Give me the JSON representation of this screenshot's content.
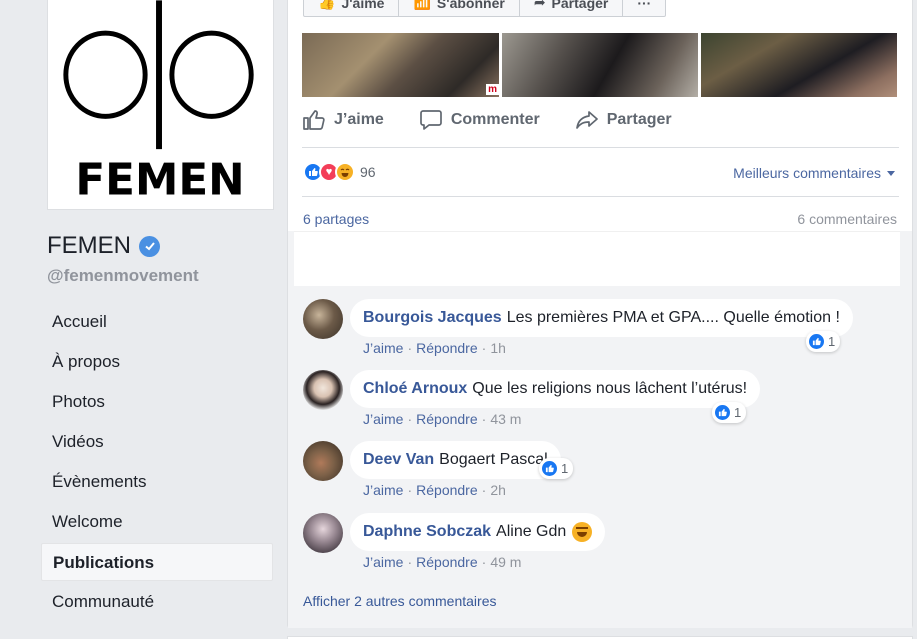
{
  "colors": {
    "link": "#385898",
    "accent": "#1877f2",
    "background": "#e9ebee"
  },
  "profile": {
    "logo_text": "FEMEN",
    "name": "FEMEN",
    "handle": "@femenmovement",
    "verified_icon": "verified-badge-icon"
  },
  "nav": {
    "items": [
      {
        "label": "Accueil"
      },
      {
        "label": "À propos"
      },
      {
        "label": "Photos"
      },
      {
        "label": "Vidéos"
      },
      {
        "label": "Évènements"
      },
      {
        "label": "Welcome"
      },
      {
        "label": "Publications",
        "active": true
      },
      {
        "label": "Communauté"
      }
    ]
  },
  "post": {
    "top_buttons": {
      "like": "J'aime",
      "subscribe": "S'abonner",
      "share": "Partager",
      "more": "···"
    },
    "photo_badge": "m",
    "actions": {
      "like": "J’aime",
      "comment": "Commenter",
      "share": "Partager"
    },
    "reactions": {
      "count": "96",
      "types": [
        "like",
        "love",
        "haha"
      ]
    },
    "sort_label": "Meilleurs commentaires",
    "shares_label": "6 partages",
    "comments_label": "6 commentaires",
    "comments": [
      {
        "author": "Bourgois Jacques",
        "text": "Les premières PMA et GPA.... Quelle émotion !",
        "like_label": "J’aime",
        "reply_label": "Répondre",
        "time": "1h",
        "reaction_count": "1"
      },
      {
        "author": "Chloé Arnoux",
        "text": "Que les religions nous lâchent l’utérus!",
        "like_label": "J’aime",
        "reply_label": "Répondre",
        "time": "43 m",
        "reaction_count": "1"
      },
      {
        "author": "Deev Van",
        "text": "Bogaert Pascal",
        "like_label": "J’aime",
        "reply_label": "Répondre",
        "time": "2h",
        "reaction_count": "1"
      },
      {
        "author": "Daphne Sobczak",
        "text": "Aline Gdn",
        "like_label": "J’aime",
        "reply_label": "Répondre",
        "time": "49 m"
      }
    ],
    "more_comments": "Afficher 2 autres commentaires"
  }
}
